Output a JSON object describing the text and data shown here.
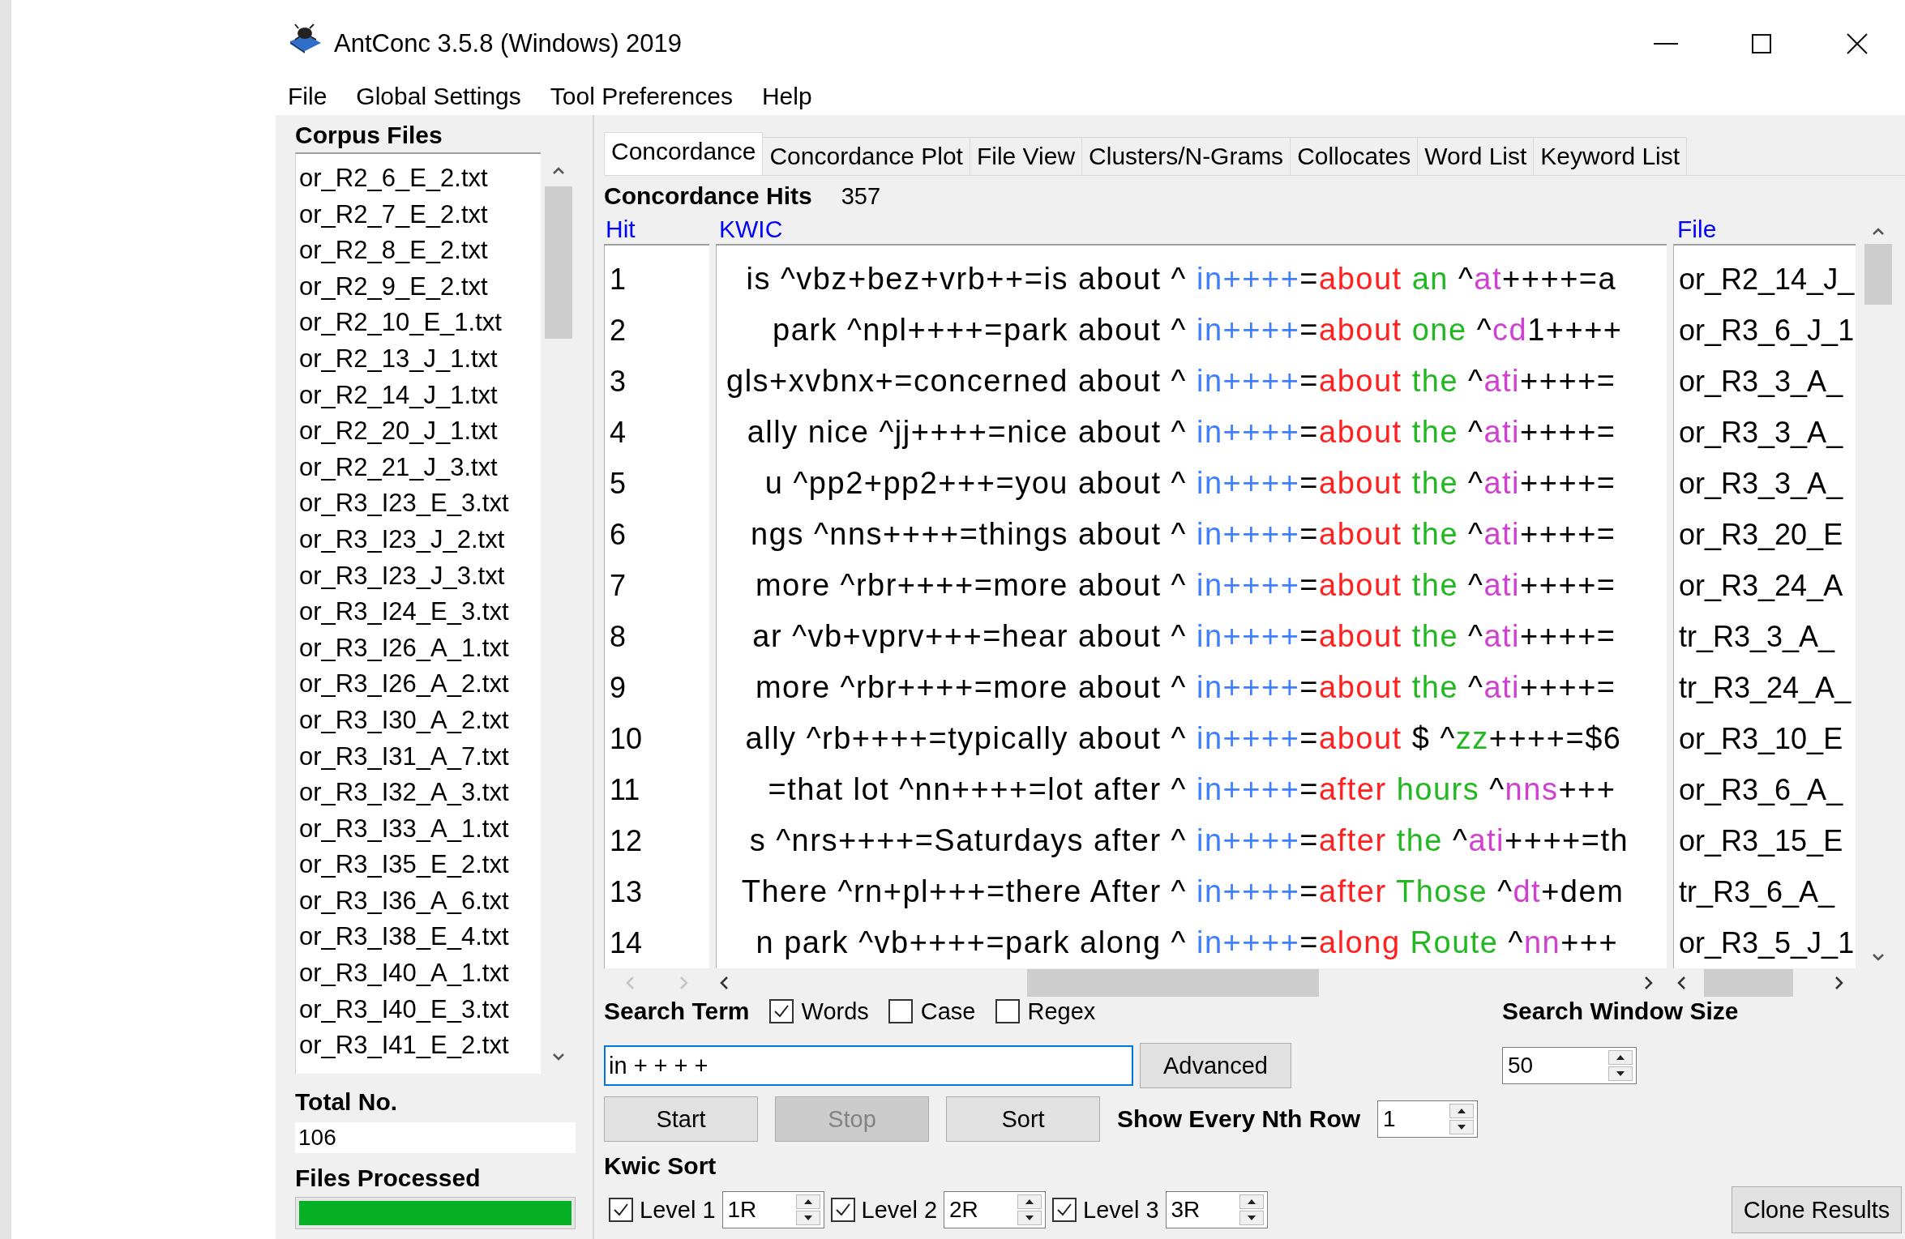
{
  "window": {
    "title": "AntConc 3.5.8 (Windows) 2019"
  },
  "menu": [
    "File",
    "Global Settings",
    "Tool Preferences",
    "Help"
  ],
  "corpus_files": {
    "heading": "Corpus Files",
    "items": [
      "or_R2_6_E_2.txt",
      "or_R2_7_E_2.txt",
      "or_R2_8_E_2.txt",
      "or_R2_9_E_2.txt",
      "or_R2_10_E_1.txt",
      "or_R2_13_J_1.txt",
      "or_R2_14_J_1.txt",
      "or_R2_20_J_1.txt",
      "or_R2_21_J_3.txt",
      "or_R3_I23_E_3.txt",
      "or_R3_I23_J_2.txt",
      "or_R3_I23_J_3.txt",
      "or_R3_I24_E_3.txt",
      "or_R3_I26_A_1.txt",
      "or_R3_I26_A_2.txt",
      "or_R3_I30_A_2.txt",
      "or_R3_I31_A_7.txt",
      "or_R3_I32_A_3.txt",
      "or_R3_I33_A_1.txt",
      "or_R3_I35_E_2.txt",
      "or_R3_I36_A_6.txt",
      "or_R3_I38_E_4.txt",
      "or_R3_I40_A_1.txt",
      "or_R3_I40_E_3.txt",
      "or_R3_I41_E_2.txt"
    ],
    "total_label": "Total No.",
    "total": "106",
    "processed": {
      "label": "Files Processed",
      "level": 1
    }
  },
  "tabs": [
    {
      "label": "Concordance",
      "selected": true
    },
    {
      "label": "Concordance Plot",
      "selected": false
    },
    {
      "label": "File View",
      "selected": false
    },
    {
      "label": "Clusters/N-Grams",
      "selected": false
    },
    {
      "label": "Collocates",
      "selected": false
    },
    {
      "label": "Word List",
      "selected": false
    },
    {
      "label": "Keyword List",
      "selected": false
    }
  ],
  "hits": {
    "label": "Concordance Hits",
    "value": "357"
  },
  "table": {
    "columns": [
      "Hit",
      "KWIC",
      "File"
    ],
    "rows": [
      {
        "hit": "1",
        "left": "is ^vbz+bez+vrb++=is about ^ ",
        "right": [
          {
            "text": "in++++",
            "color": "#3f7fff"
          },
          {
            "text": "=",
            "color": "#000000"
          },
          {
            "text": "about",
            "color": "#ff2020"
          },
          {
            "text": " an",
            "color": "#22b822"
          },
          {
            "text": " ^",
            "color": "#000000"
          },
          {
            "text": "at",
            "color": "#d040d0"
          },
          {
            "text": "++++=a",
            "color": "#000000"
          }
        ],
        "file": "or_R2_14_J_"
      },
      {
        "hit": "2",
        "left": "park ^npl++++=park about ^ ",
        "right": [
          {
            "text": "in++++",
            "color": "#3f7fff"
          },
          {
            "text": "=",
            "color": "#000000"
          },
          {
            "text": "about",
            "color": "#ff2020"
          },
          {
            "text": " one",
            "color": "#22b822"
          },
          {
            "text": " ^",
            "color": "#000000"
          },
          {
            "text": "cd",
            "color": "#d040d0"
          },
          {
            "text": "1++++",
            "color": "#000000"
          }
        ],
        "file": "or_R3_6_J_1"
      },
      {
        "hit": "3",
        "left": "gls+xvbnx+=concerned about ^ ",
        "right": [
          {
            "text": "in++++",
            "color": "#3f7fff"
          },
          {
            "text": "=",
            "color": "#000000"
          },
          {
            "text": "about",
            "color": "#ff2020"
          },
          {
            "text": " the",
            "color": "#22b822"
          },
          {
            "text": " ^",
            "color": "#000000"
          },
          {
            "text": "ati",
            "color": "#d040d0"
          },
          {
            "text": "++++=",
            "color": "#000000"
          }
        ],
        "file": "or_R3_3_A_"
      },
      {
        "hit": "4",
        "left": "ally nice ^jj++++=nice about ^ ",
        "right": [
          {
            "text": "in++++",
            "color": "#3f7fff"
          },
          {
            "text": "=",
            "color": "#000000"
          },
          {
            "text": "about",
            "color": "#ff2020"
          },
          {
            "text": " the",
            "color": "#22b822"
          },
          {
            "text": " ^",
            "color": "#000000"
          },
          {
            "text": "ati",
            "color": "#d040d0"
          },
          {
            "text": "++++=",
            "color": "#000000"
          }
        ],
        "file": "or_R3_3_A_"
      },
      {
        "hit": "5",
        "left": "u ^pp2+pp2+++=you about ^ ",
        "right": [
          {
            "text": "in++++",
            "color": "#3f7fff"
          },
          {
            "text": "=",
            "color": "#000000"
          },
          {
            "text": "about",
            "color": "#ff2020"
          },
          {
            "text": " the",
            "color": "#22b822"
          },
          {
            "text": " ^",
            "color": "#000000"
          },
          {
            "text": "ati",
            "color": "#d040d0"
          },
          {
            "text": "++++=",
            "color": "#000000"
          }
        ],
        "file": "or_R3_3_A_"
      },
      {
        "hit": "6",
        "left": "ngs ^nns++++=things about ^ ",
        "right": [
          {
            "text": "in++++",
            "color": "#3f7fff"
          },
          {
            "text": "=",
            "color": "#000000"
          },
          {
            "text": "about",
            "color": "#ff2020"
          },
          {
            "text": " the",
            "color": "#22b822"
          },
          {
            "text": " ^",
            "color": "#000000"
          },
          {
            "text": "ati",
            "color": "#d040d0"
          },
          {
            "text": "++++=",
            "color": "#000000"
          }
        ],
        "file": "or_R3_20_E"
      },
      {
        "hit": "7",
        "left": "more ^rbr++++=more about ^ ",
        "right": [
          {
            "text": "in++++",
            "color": "#3f7fff"
          },
          {
            "text": "=",
            "color": "#000000"
          },
          {
            "text": "about",
            "color": "#ff2020"
          },
          {
            "text": " the",
            "color": "#22b822"
          },
          {
            "text": " ^",
            "color": "#000000"
          },
          {
            "text": "ati",
            "color": "#d040d0"
          },
          {
            "text": "++++=",
            "color": "#000000"
          }
        ],
        "file": "or_R3_24_A"
      },
      {
        "hit": "8",
        "left": "ar ^vb+vprv+++=hear about ^ ",
        "right": [
          {
            "text": "in++++",
            "color": "#3f7fff"
          },
          {
            "text": "=",
            "color": "#000000"
          },
          {
            "text": "about",
            "color": "#ff2020"
          },
          {
            "text": " the",
            "color": "#22b822"
          },
          {
            "text": " ^",
            "color": "#000000"
          },
          {
            "text": "ati",
            "color": "#d040d0"
          },
          {
            "text": "++++=",
            "color": "#000000"
          }
        ],
        "file": "tr_R3_3_A_"
      },
      {
        "hit": "9",
        "left": "more ^rbr++++=more about ^ ",
        "right": [
          {
            "text": "in++++",
            "color": "#3f7fff"
          },
          {
            "text": "=",
            "color": "#000000"
          },
          {
            "text": "about",
            "color": "#ff2020"
          },
          {
            "text": " the",
            "color": "#22b822"
          },
          {
            "text": " ^",
            "color": "#000000"
          },
          {
            "text": "ati",
            "color": "#d040d0"
          },
          {
            "text": "++++=",
            "color": "#000000"
          }
        ],
        "file": "tr_R3_24_A_"
      },
      {
        "hit": "10",
        "left": "ally ^rb++++=typically about ^ ",
        "right": [
          {
            "text": "in++++",
            "color": "#3f7fff"
          },
          {
            "text": "=",
            "color": "#000000"
          },
          {
            "text": "about",
            "color": "#ff2020"
          },
          {
            "text": " $ ^",
            "color": "#000000"
          },
          {
            "text": "zz",
            "color": "#22b822"
          },
          {
            "text": "++++=$6",
            "color": "#000000"
          }
        ],
        "file": "or_R3_10_E"
      },
      {
        "hit": "11",
        "left": "=that lot ^nn++++=lot after ^ ",
        "right": [
          {
            "text": "in++++",
            "color": "#3f7fff"
          },
          {
            "text": "=",
            "color": "#000000"
          },
          {
            "text": "after",
            "color": "#ff2020"
          },
          {
            "text": " hours",
            "color": "#22b822"
          },
          {
            "text": " ^",
            "color": "#000000"
          },
          {
            "text": "nns",
            "color": "#d040d0"
          },
          {
            "text": "+++",
            "color": "#000000"
          }
        ],
        "file": "or_R3_6_A_"
      },
      {
        "hit": "12",
        "left": "s ^nrs++++=Saturdays after ^ ",
        "right": [
          {
            "text": "in++++",
            "color": "#3f7fff"
          },
          {
            "text": "=",
            "color": "#000000"
          },
          {
            "text": "after",
            "color": "#ff2020"
          },
          {
            "text": " the",
            "color": "#22b822"
          },
          {
            "text": " ^",
            "color": "#000000"
          },
          {
            "text": "ati",
            "color": "#d040d0"
          },
          {
            "text": "++++=th",
            "color": "#000000"
          }
        ],
        "file": "or_R3_15_E"
      },
      {
        "hit": "13",
        "left": "There ^rn+pl+++=there After ^ ",
        "right": [
          {
            "text": "in++++",
            "color": "#3f7fff"
          },
          {
            "text": "=",
            "color": "#000000"
          },
          {
            "text": "after",
            "color": "#ff2020"
          },
          {
            "text": " Those",
            "color": "#22b822"
          },
          {
            "text": " ^",
            "color": "#000000"
          },
          {
            "text": "dt",
            "color": "#d040d0"
          },
          {
            "text": "+dem",
            "color": "#000000"
          }
        ],
        "file": "tr_R3_6_A_"
      },
      {
        "hit": "14",
        "left": "n park ^vb++++=park along ^ ",
        "right": [
          {
            "text": "in++++",
            "color": "#3f7fff"
          },
          {
            "text": "=",
            "color": "#000000"
          },
          {
            "text": "along",
            "color": "#ff2020"
          },
          {
            "text": " Route",
            "color": "#22b822"
          },
          {
            "text": " ^",
            "color": "#000000"
          },
          {
            "text": "nn",
            "color": "#d040d0"
          },
          {
            "text": "+++",
            "color": "#000000"
          }
        ],
        "file": "or_R3_5_J_1"
      }
    ]
  },
  "search": {
    "label": "Search Term",
    "options": [
      {
        "label": "Words",
        "checked": true
      },
      {
        "label": "Case",
        "checked": false
      },
      {
        "label": "Regex",
        "checked": false
      }
    ],
    "value": "in + + + +",
    "advanced": "Advanced"
  },
  "window_size": {
    "label": "Search Window Size",
    "value": "50"
  },
  "actions": [
    {
      "label": "Start",
      "disabled": false
    },
    {
      "label": "Stop",
      "disabled": true
    },
    {
      "label": "Sort",
      "disabled": false
    }
  ],
  "nth_row": {
    "label": "Show Every Nth Row",
    "value": "1"
  },
  "kwic_sort": {
    "label": "Kwic Sort",
    "levels": [
      {
        "label": "Level 1",
        "checked": true,
        "value": "1R"
      },
      {
        "label": "Level 2",
        "checked": true,
        "value": "2R"
      },
      {
        "label": "Level 3",
        "checked": true,
        "value": "3R"
      }
    ]
  },
  "clone": "Clone Results"
}
